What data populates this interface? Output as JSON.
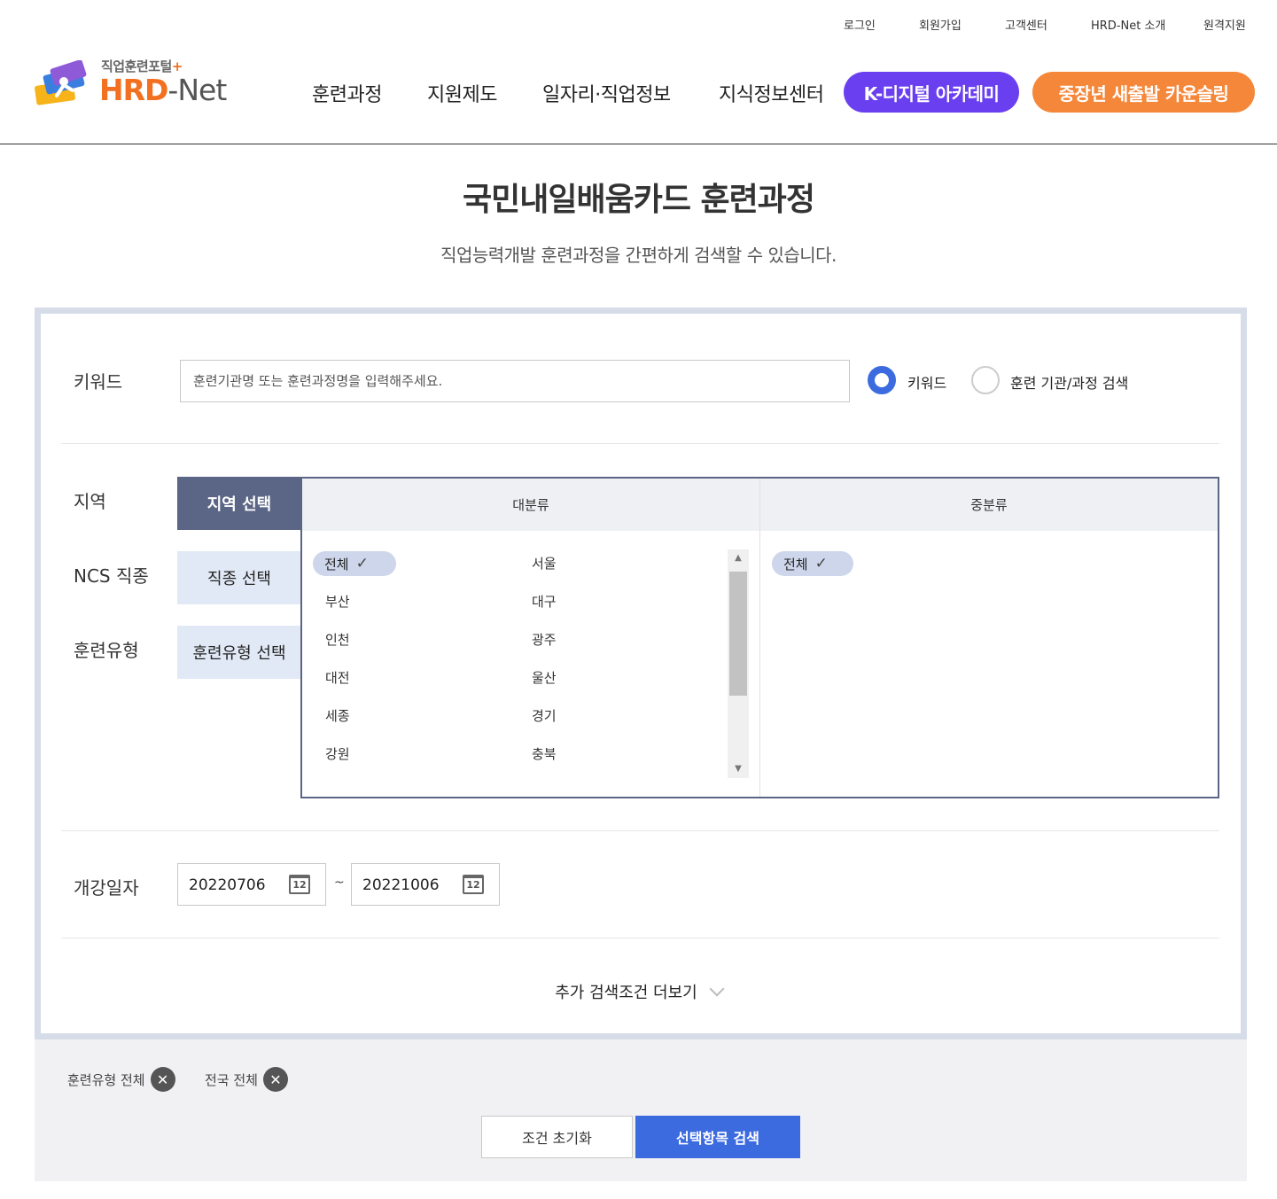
{
  "util_links": [
    "로그인",
    "회원가입",
    "고객센터",
    "HRD-Net 소개",
    "원격지원"
  ],
  "logo": {
    "sub": "직업훈련포털",
    "plus": "+",
    "brand_a": "HRD",
    "brand_dash": "-",
    "brand_b": "Net"
  },
  "nav": [
    "훈련과정",
    "지원제도",
    "일자리·직업정보",
    "지식정보센터"
  ],
  "pills": {
    "digital": "K-디지털 아카데미",
    "counsel": "중장년 새출발 카운슬링"
  },
  "page": {
    "title": "국민내일배움카드 훈련과정",
    "subtitle": "직업능력개발 훈련과정을 간편하게 검색할 수 있습니다."
  },
  "keyword": {
    "label": "키워드",
    "placeholder": "훈련기관명 또는 훈련과정명을 입력해주세요.",
    "radio_keyword": "키워드",
    "radio_org": "훈련 기관/과정 검색",
    "selected": "키워드"
  },
  "filters": {
    "region_label": "지역",
    "ncs_label": "NCS 직종",
    "type_label": "훈련유형",
    "tabs": [
      "지역 선택",
      "직종 선택",
      "훈련유형 선택"
    ],
    "active_tab": "지역 선택"
  },
  "picker": {
    "major_header": "대분류",
    "minor_header": "중분류",
    "major_selected": "전체",
    "major_items": [
      "서울",
      "부산",
      "대구",
      "인천",
      "광주",
      "대전",
      "울산",
      "세종",
      "경기",
      "강원",
      "충북"
    ],
    "minor_selected": "전체",
    "check": "✓"
  },
  "dates": {
    "label": "개강일자",
    "start": "20220706",
    "end": "20221006",
    "sep": "~",
    "cal_num": "12"
  },
  "more_label": "추가 검색조건 더보기",
  "selected_tags": [
    "훈련유형 전체",
    "전국 전체"
  ],
  "buttons": {
    "reset": "조건 초기화",
    "search": "선택항목 검색"
  },
  "colors": {
    "accent_blue": "#3c6be0",
    "purple": "#6a3ff0",
    "orange": "#f5873a",
    "active_tab": "#5b6585"
  }
}
